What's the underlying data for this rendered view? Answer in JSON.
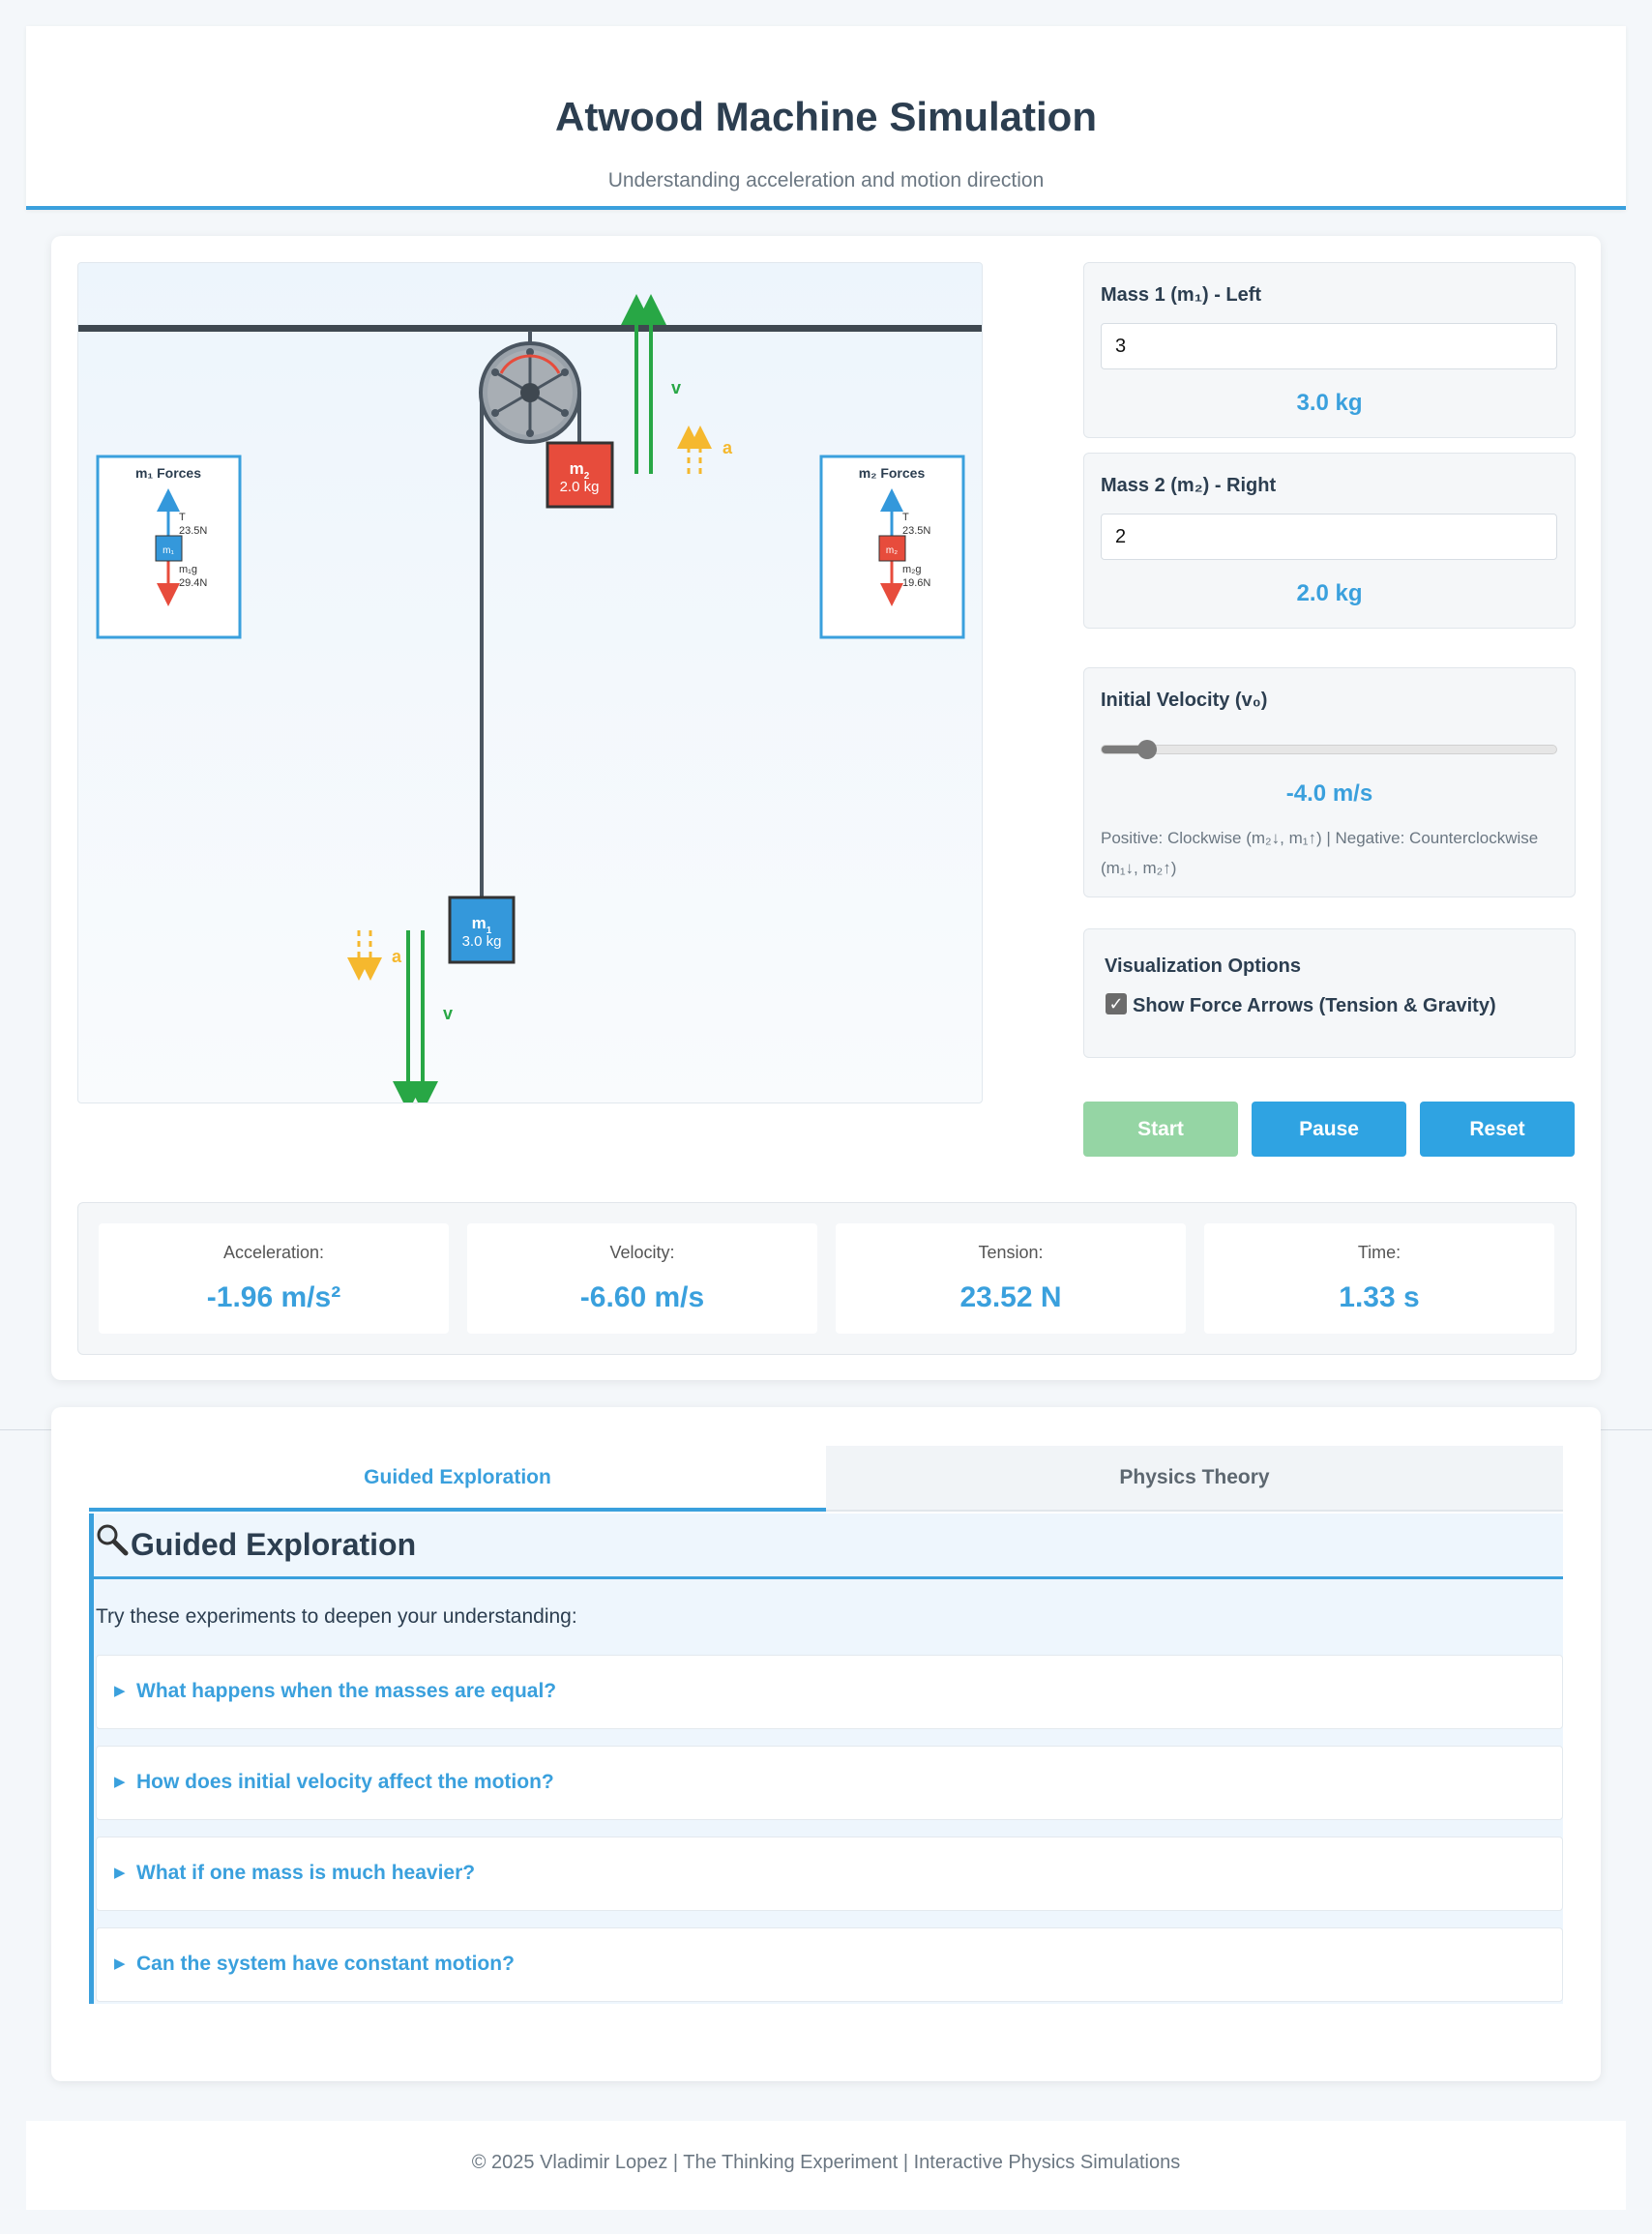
{
  "header": {
    "title": "Atwood Machine Simulation",
    "subtitle": "Understanding acceleration and motion direction"
  },
  "canvas": {
    "mass1": {
      "symbol": "m",
      "subscript": "1",
      "mass_label": "3.0 kg"
    },
    "mass2": {
      "symbol": "m",
      "subscript": "2",
      "mass_label": "2.0 kg"
    },
    "velocity_symbol": "v",
    "acceleration_symbol": "a",
    "fbd1": {
      "title": "m₁ Forces",
      "tension_symbol": "T",
      "tension": "23.5N",
      "gravity_symbol": "m₁g",
      "gravity": "29.4N",
      "block": "m₁"
    },
    "fbd2": {
      "title": "m₂ Forces",
      "tension_symbol": "T",
      "tension": "23.5N",
      "gravity_symbol": "m₂g",
      "gravity": "19.6N",
      "block": "m₂"
    },
    "colors": {
      "mass1": "#3498db",
      "mass2": "#e74c3c",
      "velocity": "#28a745",
      "acceleration": "#f5b82e",
      "rope": "#4a5560",
      "pulley": "#9aa2aa"
    }
  },
  "controls": {
    "mass1": {
      "label": "Mass 1 (m₁) - Left",
      "input_value": "3",
      "display": "3.0 kg"
    },
    "mass2": {
      "label": "Mass 2 (m₂) - Right",
      "input_value": "2",
      "display": "2.0 kg"
    },
    "velocity": {
      "label": "Initial Velocity (v₀)",
      "display": "-4.0 m/s",
      "slider_fraction": 0.1,
      "hint": "Positive: Clockwise (m₂↓, m₁↑) | Negative: Counterclockwise (m₁↓, m₂↑)"
    },
    "visualization": {
      "title": "Visualization Options",
      "checkbox_label": "Show Force Arrows (Tension & Gravity)",
      "checked": true
    },
    "buttons": {
      "start": "Start",
      "pause": "Pause",
      "reset": "Reset"
    },
    "button_colors": {
      "start": "#95d5a4",
      "pause": "#2fa3e2",
      "reset": "#2fa3e2"
    }
  },
  "stats": [
    {
      "label": "Acceleration:",
      "value": "-1.96 m/s²"
    },
    {
      "label": "Velocity:",
      "value": "-6.60 m/s"
    },
    {
      "label": "Tension:",
      "value": "23.52 N"
    },
    {
      "label": "Time:",
      "value": "1.33 s"
    }
  ],
  "tabs": {
    "active": "Guided Exploration",
    "inactive": "Physics Theory"
  },
  "guide": {
    "icon": "magnifier-icon",
    "title": "Guided Exploration",
    "intro": "Try these experiments to deepen your understanding:",
    "questions": [
      "What happens when the masses are equal?",
      "How does initial velocity affect the motion?",
      "What if one mass is much heavier?",
      "Can the system have constant motion?"
    ]
  },
  "footer": {
    "text": "© 2025 Vladimir Lopez | The Thinking Experiment | Interactive Physics Simulations"
  }
}
